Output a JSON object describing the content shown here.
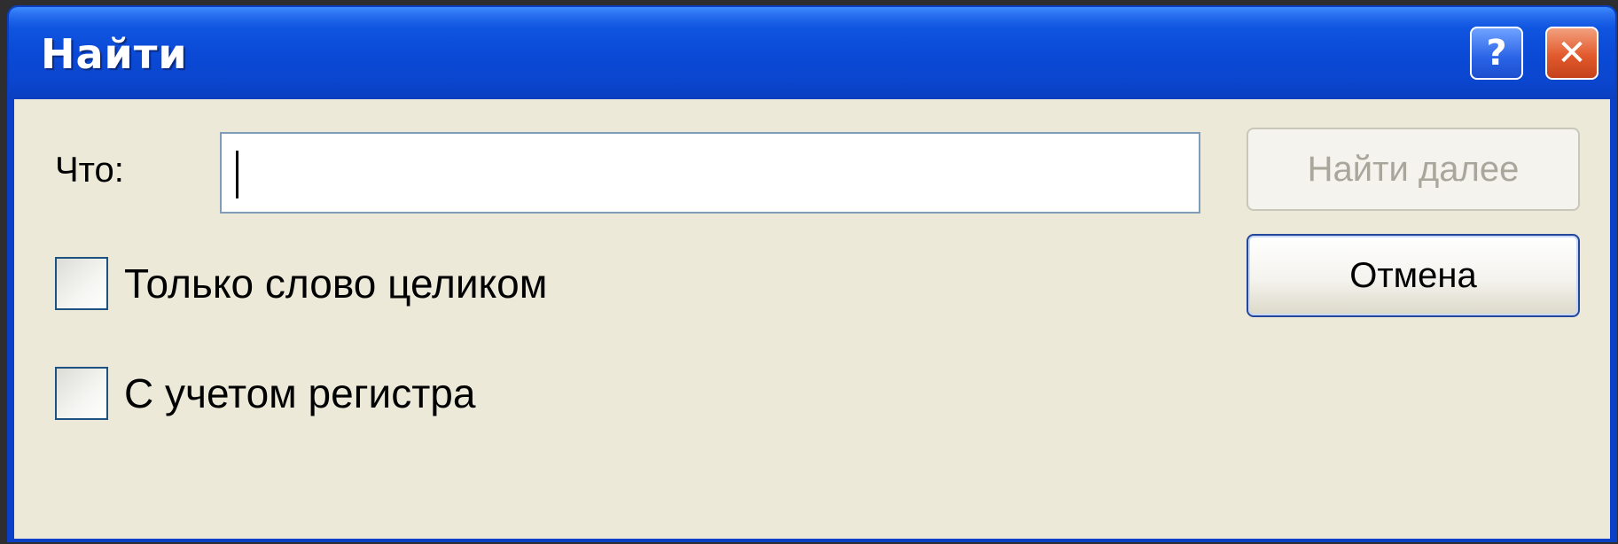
{
  "window": {
    "title": "Найти",
    "help_glyph": "?",
    "close_glyph": "✕"
  },
  "form": {
    "what_label": "Что:",
    "search_value": ""
  },
  "buttons": {
    "find_next": "Найти далее",
    "cancel": "Отмена"
  },
  "options": [
    {
      "label": "Только слово целиком",
      "checked": false
    },
    {
      "label": "С учетом регистра",
      "checked": false
    }
  ],
  "colors": {
    "titlebar": "#0a4ad6",
    "client_bg": "#ece9d8",
    "close_button": "#e25a2c",
    "help_button": "#2a63e6"
  }
}
